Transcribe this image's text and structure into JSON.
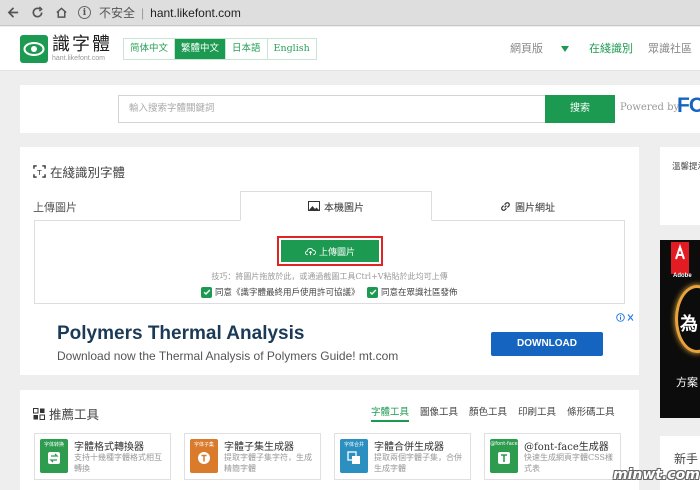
{
  "browser": {
    "security_label": "不安全",
    "url": "hant.likefont.com"
  },
  "header": {
    "logo_title": "識字體",
    "logo_sub": "hant.likefont.com",
    "languages": [
      {
        "label": "简体中文",
        "active": false
      },
      {
        "label": "繁體中文",
        "active": true
      },
      {
        "label": "日本語",
        "active": false
      },
      {
        "label": "English",
        "active": false
      }
    ],
    "nav_web": "網頁版",
    "nav_online": "在綫識別",
    "nav_community": "眾識社區"
  },
  "search": {
    "placeholder": "輸入搜索字體關鍵詞",
    "button": "搜索",
    "powered_by": "Powered by",
    "brand_partial": "FO",
    "close": "✕"
  },
  "main": {
    "title": "在綫識別字體",
    "tab_upload": "上傳圖片",
    "tab_local": "本機圖片",
    "tab_url": "圖片網址",
    "upload_button": "上傳圖片",
    "tip": "技巧：將圖片拖放於此，或通過截圖工具Ctrl+V粘貼於此均可上傳",
    "agree_terms": "同意《識字體最終用戶使用許可協議》",
    "agree_publish": "同意在眾識社區發佈"
  },
  "ad": {
    "title": "Polymers Thermal Analysis",
    "subtitle": "Download now the Thermal Analysis of Polymers Guide! mt.com",
    "button": "DOWNLOAD"
  },
  "tools": {
    "title": "推薦工具",
    "tabs": [
      {
        "label": "字體工具",
        "active": true
      },
      {
        "label": "圖像工具",
        "active": false
      },
      {
        "label": "顏色工具",
        "active": false
      },
      {
        "label": "印刷工具",
        "active": false
      },
      {
        "label": "條形碼工具",
        "active": false
      }
    ],
    "items": [
      {
        "name": "字體格式轉換器",
        "desc": "支持十幾種字體格式相互轉換",
        "icon_label": "字体转换",
        "color": "#2e9c4f",
        "icon": "convert-icon"
      },
      {
        "name": "字體子集生成器",
        "desc": "提取字體子集字符，生成精簡字體",
        "icon_label": "字体子集",
        "color": "#d97b2b",
        "icon": "subset-icon"
      },
      {
        "name": "字體合併生成器",
        "desc": "提取兩個字體子集，合併生成字體",
        "icon_label": "字体合并",
        "color": "#2b8fc0",
        "icon": "merge-icon"
      },
      {
        "name": "@font-face生成器",
        "desc": "快速生成網頁字體CSS樣式表",
        "icon_label": "@font-face",
        "color": "#2e9c4f",
        "icon": "fontface-icon"
      }
    ]
  },
  "right": {
    "tip_title": "溫馨提示",
    "adobe_text": "Adobe",
    "ad_big": "為",
    "ad_small": "方案",
    "card3_title": "新手"
  },
  "watermark": "minwt.com"
}
